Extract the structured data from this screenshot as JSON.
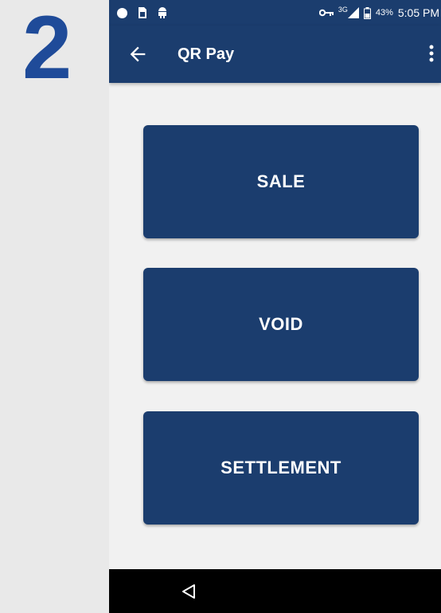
{
  "step": {
    "number": "2"
  },
  "status_bar": {
    "battery": "43%",
    "time": "5:05 PM",
    "network": "3G",
    "icons": [
      "circle-icon",
      "sim-icon",
      "android-icon",
      "key-icon",
      "signal-icon",
      "battery-icon"
    ]
  },
  "app_bar": {
    "title": "QR Pay",
    "icons": [
      "arrow-back-icon",
      "more-vert-icon"
    ]
  },
  "buttons": {
    "sale": "SALE",
    "void": "VOID",
    "settlement": "SETTLEMENT"
  },
  "nav_bar": {
    "icons": [
      "nav-back-icon"
    ]
  },
  "colors": {
    "primary": "#1b3d6e",
    "step_number": "#1f4b99",
    "background": "#f1f1f1"
  }
}
